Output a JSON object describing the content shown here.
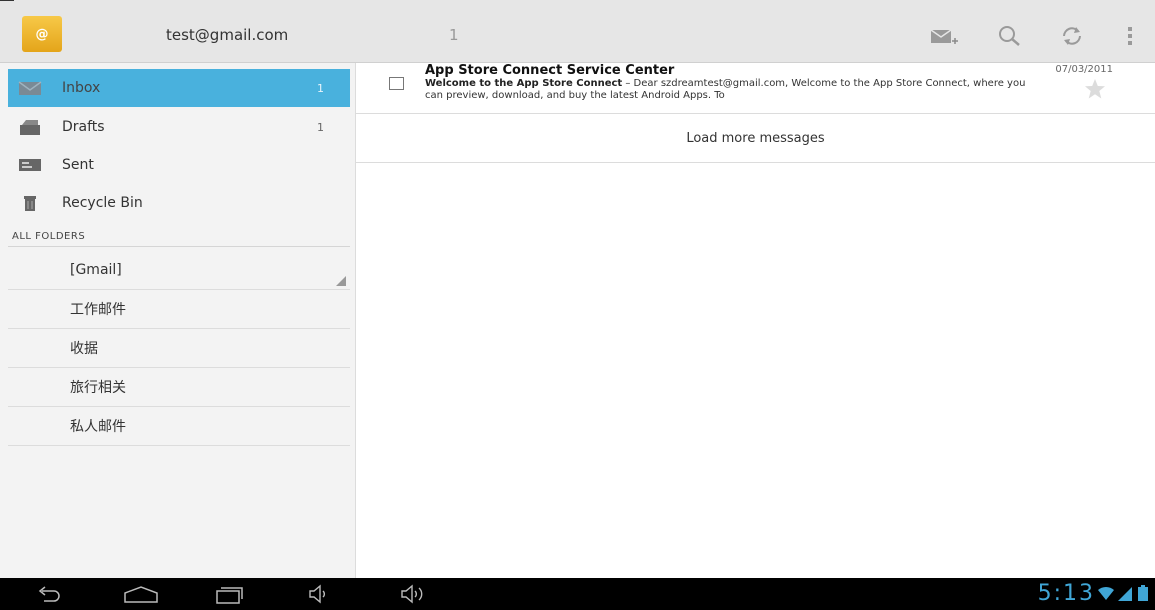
{
  "header": {
    "account": "test@gmail.com",
    "unread_count": "1",
    "app_icon_symbol": "@",
    "actions": [
      "compose-icon",
      "search-icon",
      "refresh-icon",
      "overflow-menu-icon"
    ]
  },
  "sidebar": {
    "items": [
      {
        "label": "Inbox",
        "count": "1",
        "icon": "inbox-icon",
        "active": true
      },
      {
        "label": "Drafts",
        "count": "1",
        "icon": "drafts-icon",
        "active": false
      },
      {
        "label": "Sent",
        "count": "",
        "icon": "sent-icon",
        "active": false
      },
      {
        "label": "Recycle Bin",
        "count": "",
        "icon": "trash-icon",
        "active": false
      }
    ],
    "section_header": "ALL FOLDERS",
    "folders": [
      "[Gmail]",
      "工作邮件",
      "收据",
      "旅行相关",
      "私人邮件"
    ]
  },
  "messages": [
    {
      "sender": "App Store Connect Service Center",
      "date": "07/03/2011",
      "subject": "Welcome to the App Store Connect",
      "snippet": " – Dear szdreamtest@gmail.com, Welcome to the App Store Connect, where you can preview, download, and buy the latest Android Apps. To"
    }
  ],
  "load_more": "Load more messages",
  "status": {
    "time": "5:13"
  },
  "colors": {
    "accent": "#49b1dd",
    "clock": "#40a6d6"
  }
}
